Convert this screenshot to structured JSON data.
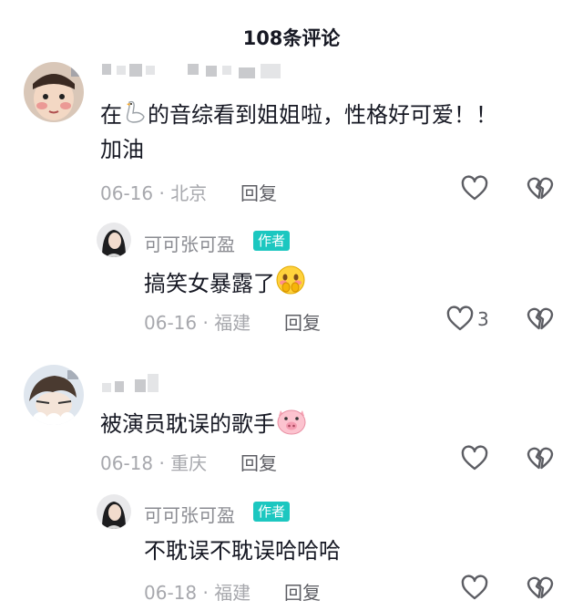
{
  "header": {
    "title": "108条评论"
  },
  "comments": [
    {
      "text": "在🪿的音综看到姐姐啦，性格好可爱！！加油",
      "text_pre": "在",
      "text_mid": "的音综看到姐姐啦，性格好可爱！！",
      "text_line2": "加油",
      "date_location": "06-16 · 北京",
      "reply_label": "回复",
      "reply": {
        "username": "可可张可盈",
        "badge": "作者",
        "text": "搞笑女暴露了",
        "date_location": "06-16 · 福建",
        "reply_label": "回复",
        "like_count": "3"
      }
    },
    {
      "text": "被演员耽误的歌手",
      "date_location": "06-18 · 重庆",
      "reply_label": "回复",
      "reply": {
        "username": "可可张可盈",
        "badge": "作者",
        "text": "不耽误不耽误哈哈哈",
        "date_location": "06-18 · 福建",
        "reply_label": "回复"
      }
    }
  ],
  "icons": {
    "like": "heart-outline-icon",
    "dislike": "broken-heart-icon",
    "goose": "goose-emoji-icon",
    "shy": "shy-face-emoji-icon",
    "pig": "pig-emoji-icon"
  },
  "colors": {
    "author_badge": "#1cc7c0",
    "secondary_text": "#a7a8ad"
  }
}
